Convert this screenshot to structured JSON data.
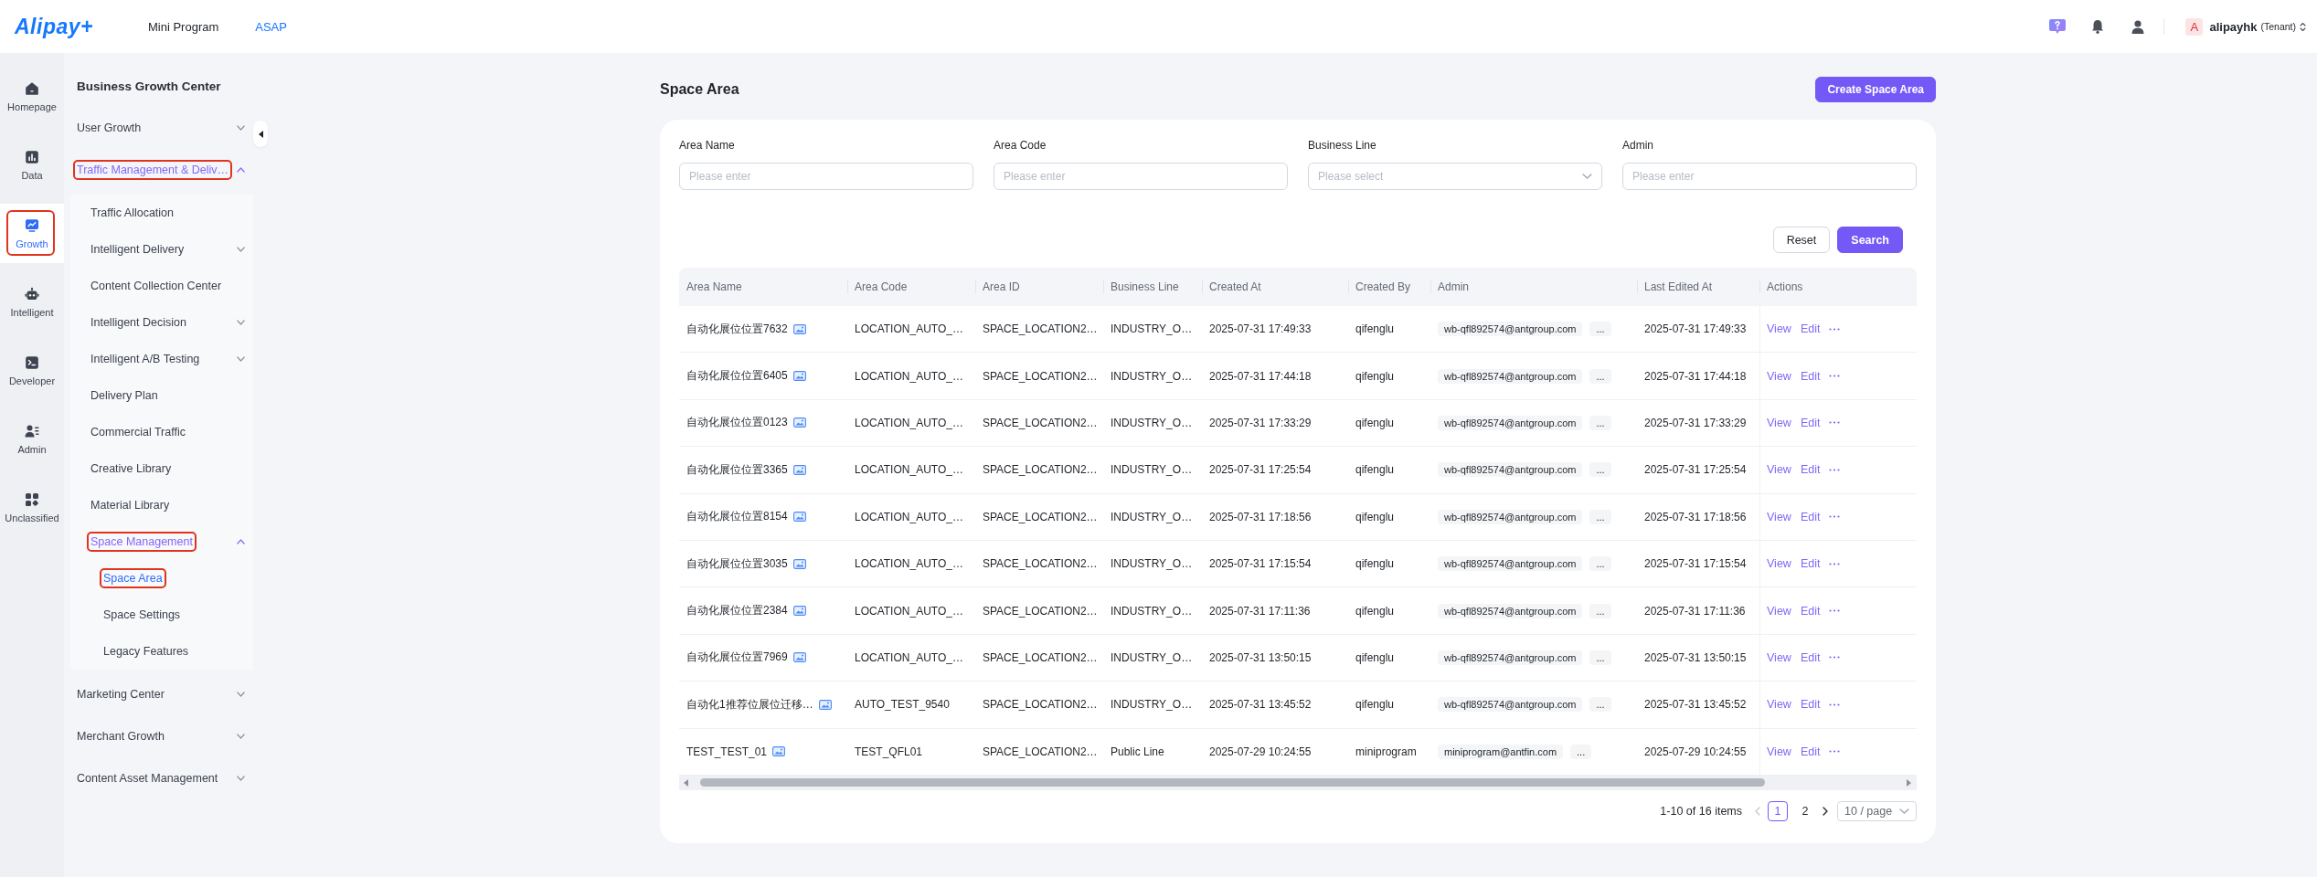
{
  "top_bar": {
    "logo": "Alipay+",
    "nav": [
      {
        "label": "Mini Program",
        "selected": false
      },
      {
        "label": "ASAP",
        "selected": true
      }
    ],
    "account": {
      "avatar": "A",
      "name": "alipayhk",
      "role": "(Tenant)"
    }
  },
  "rail": [
    {
      "label": "Homepage",
      "selected": false,
      "outlined": false
    },
    {
      "label": "Data",
      "selected": false,
      "outlined": false
    },
    {
      "label": "Growth",
      "selected": true,
      "outlined": true
    },
    {
      "label": "Intelligent",
      "selected": false,
      "outlined": false
    },
    {
      "label": "Developer",
      "selected": false,
      "outlined": false
    },
    {
      "label": "Admin",
      "selected": false,
      "outlined": false
    },
    {
      "label": "Unclassified",
      "selected": false,
      "outlined": false
    }
  ],
  "sidebar": {
    "title": "Business Growth Center",
    "items": [
      {
        "label": "User Growth",
        "kind": "group",
        "expanded": false,
        "selected": false,
        "outlined": false
      },
      {
        "label": "Traffic Management & Deliv…",
        "kind": "group",
        "expanded": true,
        "selected": true,
        "outlined": true,
        "children": [
          {
            "label": "Traffic Allocation",
            "kind": "link",
            "selected": false,
            "outlined": false
          },
          {
            "label": "Intelligent Delivery",
            "kind": "group",
            "expanded": false,
            "selected": false,
            "outlined": false
          },
          {
            "label": "Content Collection Center",
            "kind": "link",
            "selected": false,
            "outlined": false
          },
          {
            "label": "Intelligent Decision",
            "kind": "group",
            "expanded": false,
            "selected": false,
            "outlined": false
          },
          {
            "label": "Intelligent A/B Testing",
            "kind": "group",
            "expanded": false,
            "selected": false,
            "outlined": false
          },
          {
            "label": "Delivery Plan",
            "kind": "link",
            "selected": false,
            "outlined": false
          },
          {
            "label": "Commercial Traffic",
            "kind": "link",
            "selected": false,
            "outlined": false
          },
          {
            "label": "Creative Library",
            "kind": "link",
            "selected": false,
            "outlined": false
          },
          {
            "label": "Material Library",
            "kind": "link",
            "selected": false,
            "outlined": false
          },
          {
            "label": "Space Management",
            "kind": "group",
            "expanded": true,
            "selected": true,
            "outlined": true,
            "children": [
              {
                "label": "Space Area",
                "kind": "link",
                "selected": true,
                "outlined": true
              },
              {
                "label": "Space Settings",
                "kind": "link",
                "selected": false,
                "outlined": false
              },
              {
                "label": "Legacy Features",
                "kind": "link",
                "selected": false,
                "outlined": false
              }
            ]
          }
        ]
      },
      {
        "label": "Marketing Center",
        "kind": "group",
        "expanded": false,
        "selected": false,
        "outlined": false
      },
      {
        "label": "Merchant Growth",
        "kind": "group",
        "expanded": false,
        "selected": false,
        "outlined": false
      },
      {
        "label": "Content Asset Management",
        "kind": "group",
        "expanded": false,
        "selected": false,
        "outlined": false
      }
    ]
  },
  "page": {
    "title": "Space Area",
    "create_button": "Create Space Area"
  },
  "filters": {
    "fields": [
      {
        "label": "Area Name",
        "kind": "input",
        "placeholder": "Please enter"
      },
      {
        "label": "Area Code",
        "kind": "input",
        "placeholder": "Please enter"
      },
      {
        "label": "Business Line",
        "kind": "select",
        "placeholder": "Please select"
      },
      {
        "label": "Admin",
        "kind": "input",
        "placeholder": "Please enter"
      }
    ],
    "buttons": [
      {
        "label": "Reset",
        "kind": "default"
      },
      {
        "label": "Search",
        "kind": "primary"
      }
    ]
  },
  "table": {
    "columns": [
      "Area Name",
      "Area Code",
      "Area ID",
      "Business Line",
      "Created At",
      "Created By",
      "Admin",
      "Last Edited At",
      "Actions"
    ],
    "rows": [
      {
        "area_name": "自动化展位位置7632",
        "area_code": "LOCATION_AUTO_…",
        "area_id": "SPACE_LOCATION2…",
        "business_line": "INDUSTRY_O…",
        "created_at": "2025-07-31 17:49:33",
        "created_by": "qifenglu",
        "admin": "wb-qfl892574@antgroup.com",
        "admin_more": "...",
        "last_edited_at": "2025-07-31 17:49:33",
        "actions": [
          "View",
          "Edit"
        ]
      },
      {
        "area_name": "自动化展位位置6405",
        "area_code": "LOCATION_AUTO_…",
        "area_id": "SPACE_LOCATION2…",
        "business_line": "INDUSTRY_O…",
        "created_at": "2025-07-31 17:44:18",
        "created_by": "qifenglu",
        "admin": "wb-qfl892574@antgroup.com",
        "admin_more": "...",
        "last_edited_at": "2025-07-31 17:44:18",
        "actions": [
          "View",
          "Edit"
        ]
      },
      {
        "area_name": "自动化展位位置0123",
        "area_code": "LOCATION_AUTO_…",
        "area_id": "SPACE_LOCATION2…",
        "business_line": "INDUSTRY_O…",
        "created_at": "2025-07-31 17:33:29",
        "created_by": "qifenglu",
        "admin": "wb-qfl892574@antgroup.com",
        "admin_more": "...",
        "last_edited_at": "2025-07-31 17:33:29",
        "actions": [
          "View",
          "Edit"
        ]
      },
      {
        "area_name": "自动化展位位置3365",
        "area_code": "LOCATION_AUTO_…",
        "area_id": "SPACE_LOCATION2…",
        "business_line": "INDUSTRY_O…",
        "created_at": "2025-07-31 17:25:54",
        "created_by": "qifenglu",
        "admin": "wb-qfl892574@antgroup.com",
        "admin_more": "...",
        "last_edited_at": "2025-07-31 17:25:54",
        "actions": [
          "View",
          "Edit"
        ]
      },
      {
        "area_name": "自动化展位位置8154",
        "area_code": "LOCATION_AUTO_…",
        "area_id": "SPACE_LOCATION2…",
        "business_line": "INDUSTRY_O…",
        "created_at": "2025-07-31 17:18:56",
        "created_by": "qifenglu",
        "admin": "wb-qfl892574@antgroup.com",
        "admin_more": "...",
        "last_edited_at": "2025-07-31 17:18:56",
        "actions": [
          "View",
          "Edit"
        ]
      },
      {
        "area_name": "自动化展位位置3035",
        "area_code": "LOCATION_AUTO_…",
        "area_id": "SPACE_LOCATION2…",
        "business_line": "INDUSTRY_O…",
        "created_at": "2025-07-31 17:15:54",
        "created_by": "qifenglu",
        "admin": "wb-qfl892574@antgroup.com",
        "admin_more": "...",
        "last_edited_at": "2025-07-31 17:15:54",
        "actions": [
          "View",
          "Edit"
        ]
      },
      {
        "area_name": "自动化展位位置2384",
        "area_code": "LOCATION_AUTO_…",
        "area_id": "SPACE_LOCATION2…",
        "business_line": "INDUSTRY_O…",
        "created_at": "2025-07-31 17:11:36",
        "created_by": "qifenglu",
        "admin": "wb-qfl892574@antgroup.com",
        "admin_more": "...",
        "last_edited_at": "2025-07-31 17:11:36",
        "actions": [
          "View",
          "Edit"
        ]
      },
      {
        "area_name": "自动化展位位置7969",
        "area_code": "LOCATION_AUTO_…",
        "area_id": "SPACE_LOCATION2…",
        "business_line": "INDUSTRY_O…",
        "created_at": "2025-07-31 13:50:15",
        "created_by": "qifenglu",
        "admin": "wb-qfl892574@antgroup.com",
        "admin_more": "...",
        "last_edited_at": "2025-07-31 13:50:15",
        "actions": [
          "View",
          "Edit"
        ]
      },
      {
        "area_name": "自动化1推荐位展位迁移…",
        "area_code": "AUTO_TEST_9540",
        "area_id": "SPACE_LOCATION2…",
        "business_line": "INDUSTRY_O…",
        "created_at": "2025-07-31 13:45:52",
        "created_by": "qifenglu",
        "admin": "wb-qfl892574@antgroup.com",
        "admin_more": "...",
        "last_edited_at": "2025-07-31 13:45:52",
        "actions": [
          "View",
          "Edit"
        ]
      },
      {
        "area_name": "TEST_TEST_01",
        "area_code": "TEST_QFL01",
        "area_id": "SPACE_LOCATION2…",
        "business_line": "Public Line",
        "created_at": "2025-07-29 10:24:55",
        "created_by": "miniprogram",
        "admin": "miniprogram@antfin.com",
        "admin_more": "...",
        "last_edited_at": "2025-07-29 10:24:55",
        "actions": [
          "View",
          "Edit"
        ]
      }
    ]
  },
  "pagination": {
    "summary": "1-10 of 16 items",
    "prev": {
      "disabled": true
    },
    "pages": [
      {
        "label": "1",
        "selected": true
      },
      {
        "label": "2",
        "selected": false
      }
    ],
    "next": {
      "disabled": false
    },
    "page_size": "10 / page"
  }
}
